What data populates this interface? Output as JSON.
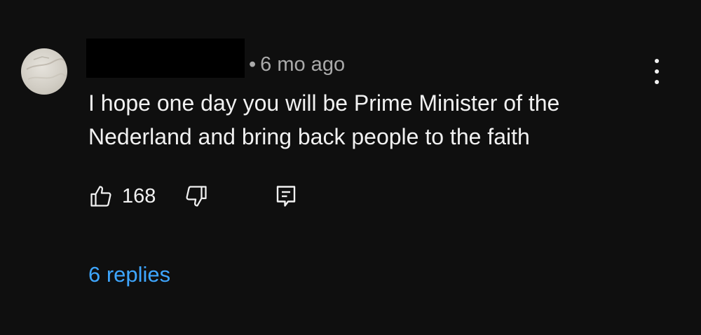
{
  "comment": {
    "time_ago": "6 mo ago",
    "separator": "•",
    "text_lines": [
      "I hope one day you will be Prime Minister of the",
      "Nederland and bring back people to the faith"
    ],
    "like_count": "168",
    "replies_label": "6 replies"
  },
  "icons": {
    "like": "thumbs-up-icon",
    "dislike": "thumbs-down-icon",
    "reply": "reply-comment-icon",
    "more": "more-vert-icon"
  },
  "colors": {
    "background": "#0f0f0f",
    "primary_text": "#f1f1f1",
    "secondary_text": "#aaaaaa",
    "link": "#3ea6ff"
  }
}
